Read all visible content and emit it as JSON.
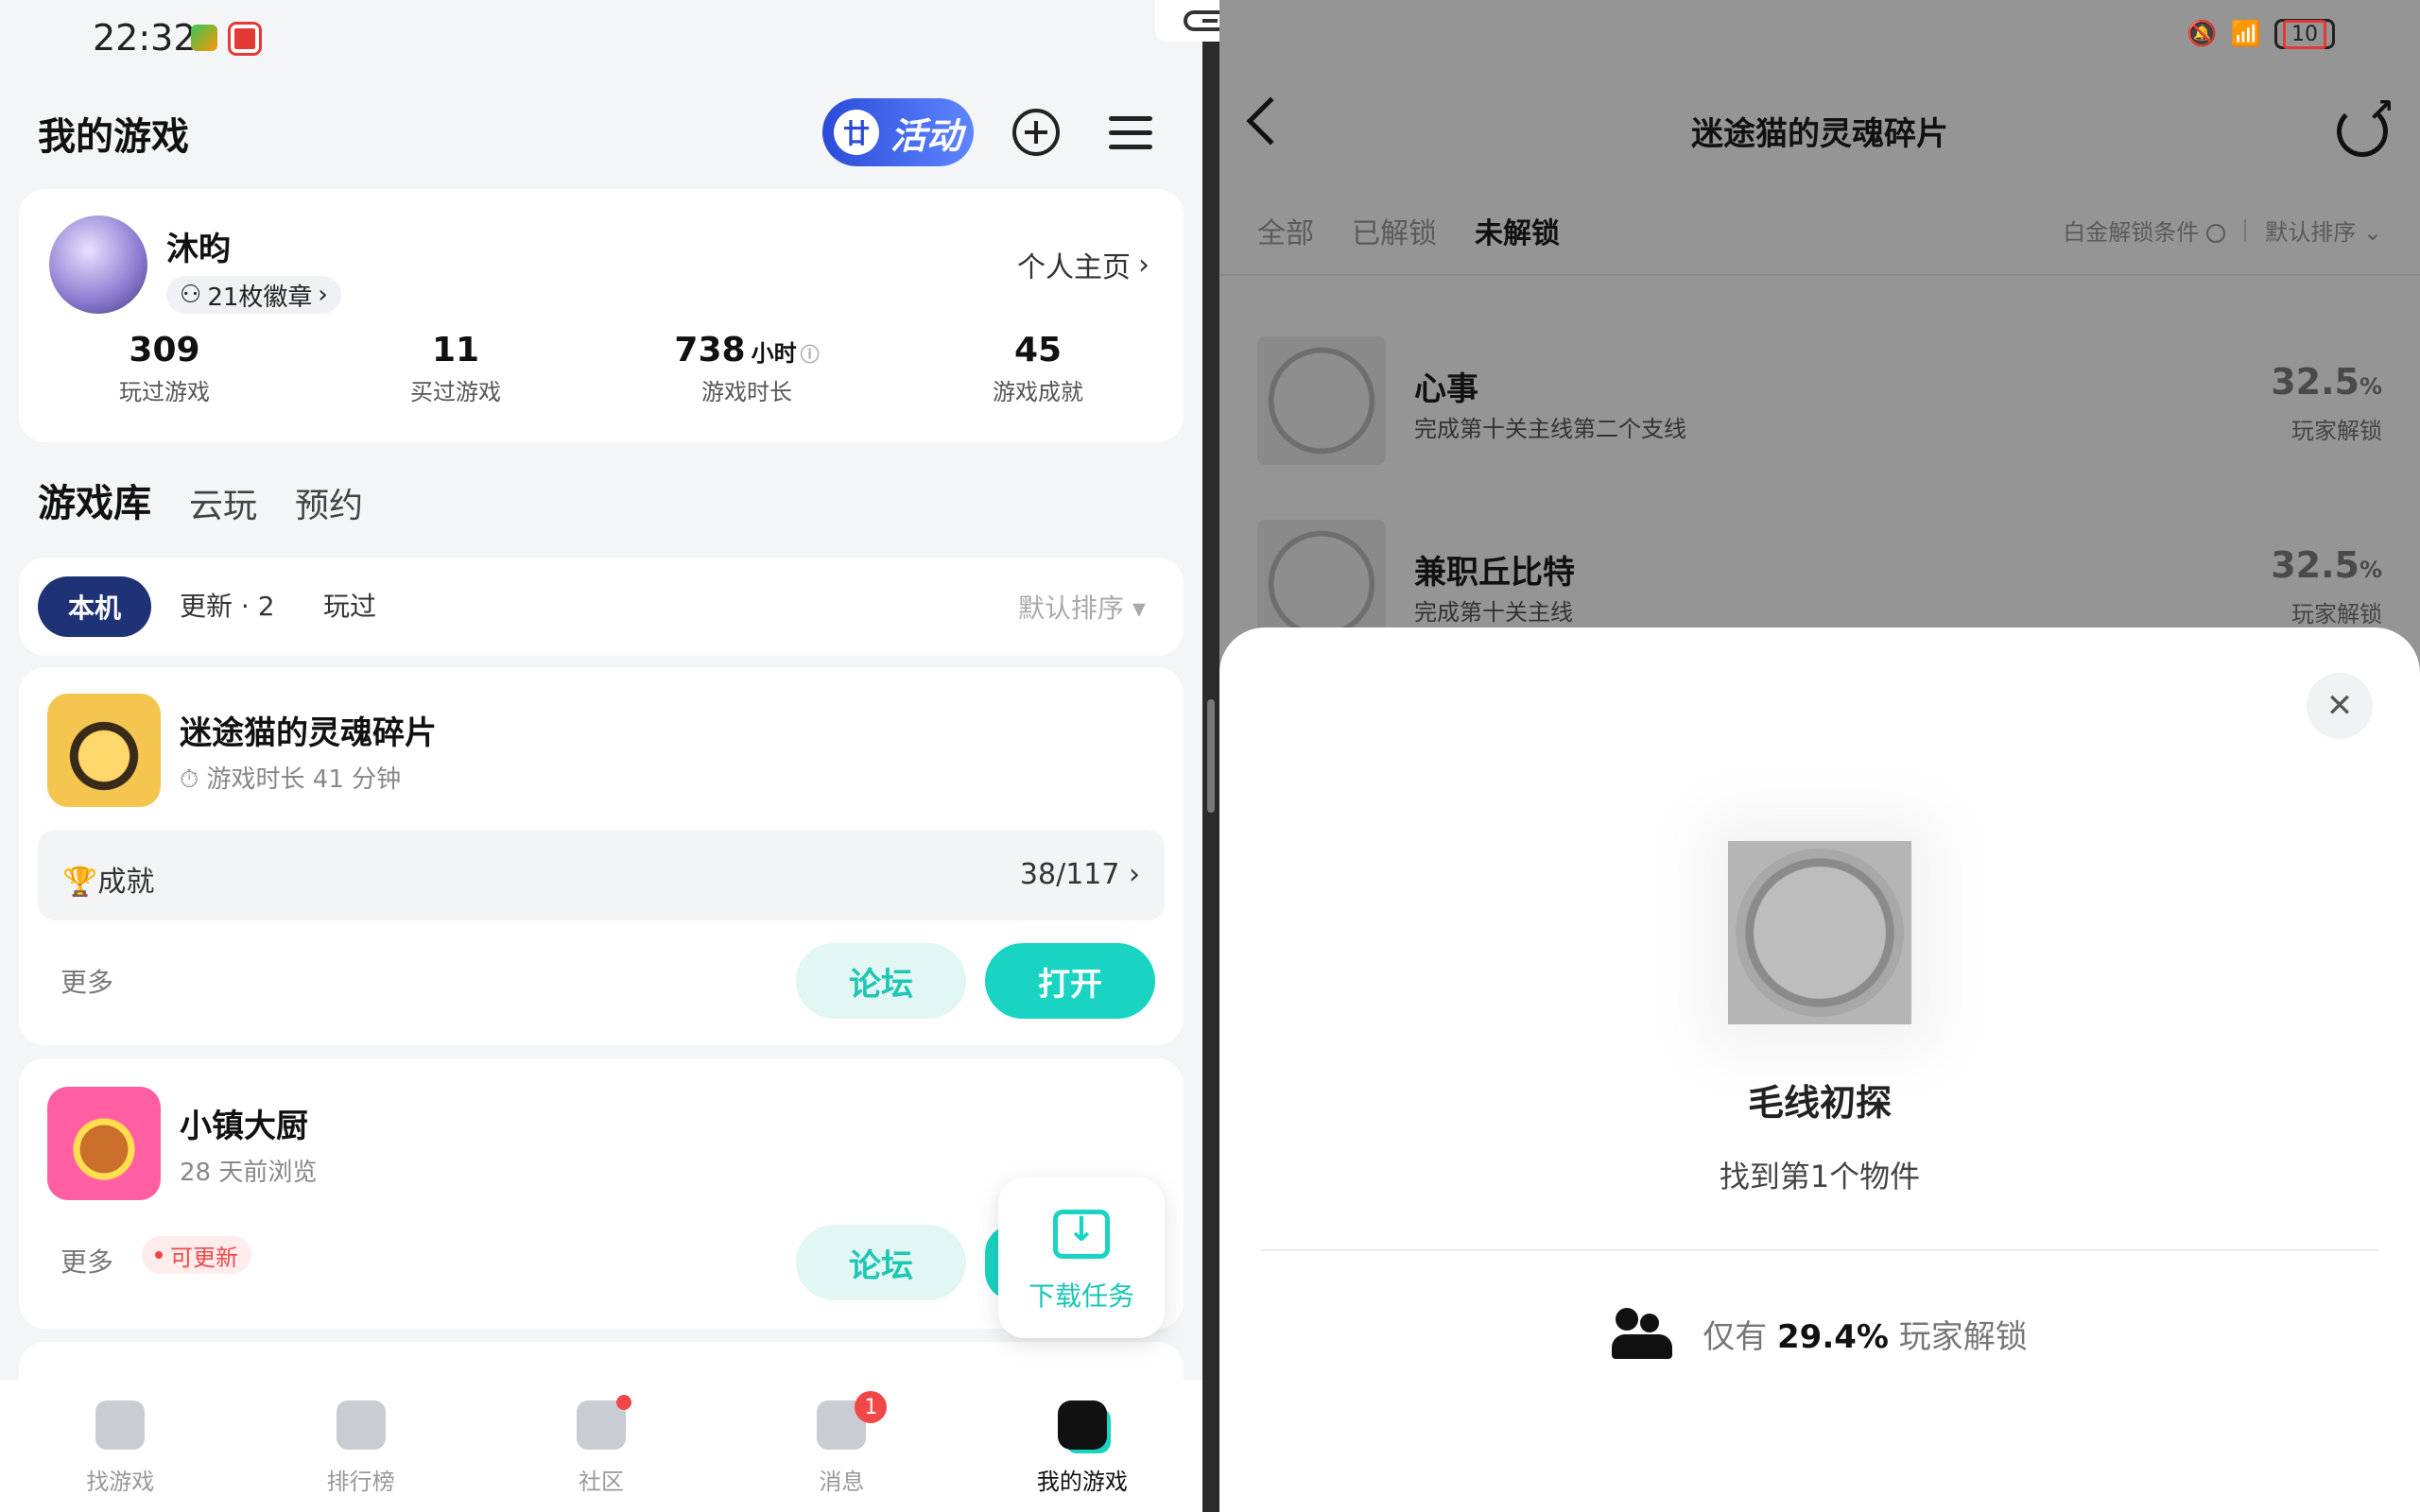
{
  "status_bar": {
    "time": "22:32",
    "battery": "10"
  },
  "left": {
    "title": "我的游戏",
    "activity_label": "活动",
    "profile": {
      "name": "沐昀",
      "badges": "21枚徽章",
      "home_link": "个人主页",
      "stats": [
        {
          "value": "309",
          "unit": "",
          "label": "玩过游戏"
        },
        {
          "value": "11",
          "unit": "",
          "label": "买过游戏"
        },
        {
          "value": "738",
          "unit": "小时",
          "label": "游戏时长"
        },
        {
          "value": "45",
          "unit": "",
          "label": "游戏成就"
        }
      ]
    },
    "tabs": [
      "游戏库",
      "云玩",
      "预约"
    ],
    "filters": {
      "active": "本机",
      "update": "更新 · 2",
      "played": "玩过",
      "sort": "默认排序 ▾"
    },
    "games": [
      {
        "name": "迷途猫的灵魂碎片",
        "sub": "游戏时长 41 分钟",
        "achievement_label": "🏆成就",
        "achievement_count": "38/117",
        "more": "更多",
        "forum": "论坛",
        "open": "打开"
      },
      {
        "name": "小镇大厨",
        "sub": "28 天前浏览",
        "more": "更多",
        "update_tag": "可更新",
        "forum": "论坛"
      }
    ],
    "download_task": "下载任务",
    "bottom_nav": [
      {
        "label": "找游戏",
        "active": false
      },
      {
        "label": "排行榜",
        "active": false
      },
      {
        "label": "社区",
        "active": false
      },
      {
        "label": "消息",
        "active": false,
        "badge": "1"
      },
      {
        "label": "我的游戏",
        "active": true
      }
    ]
  },
  "right": {
    "title": "迷途猫的灵魂碎片",
    "tabs": [
      "全部",
      "已解锁",
      "未解锁"
    ],
    "active_tab": "未解锁",
    "filter_condition": "白金解锁条件",
    "filter_sort": "默认排序",
    "achievements": [
      {
        "title": "心事",
        "desc": "完成第十关主线第二个支线",
        "pct": "32.5",
        "pct_unit": "%",
        "pct_label": "玩家解锁"
      },
      {
        "title": "兼职丘比特",
        "desc": "完成第十关主线",
        "pct": "32.5",
        "pct_unit": "%",
        "pct_label": "玩家解锁"
      }
    ],
    "sheet": {
      "name": "毛线初探",
      "desc": "找到第1个物件",
      "stat_prefix": "仅有",
      "stat_value": "29.4%",
      "stat_suffix": "玩家解锁"
    }
  }
}
